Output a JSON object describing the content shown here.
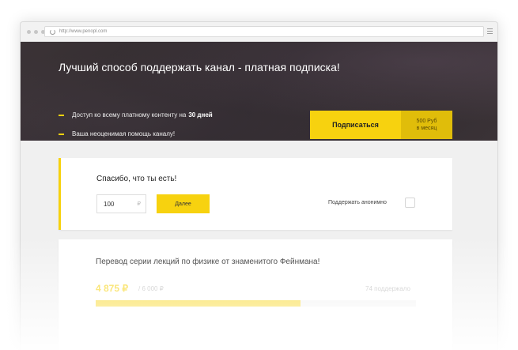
{
  "browser": {
    "url": "http://www.penopl.com",
    "menu_icon": "hamburger-icon",
    "reload_icon": "reload-icon"
  },
  "hero": {
    "title": "Лучший способ поддержать канал - платная подписка!",
    "benefits": [
      {
        "text": "Доступ ко всему платному контенту на",
        "highlight": "30 дней"
      },
      {
        "text": "Ваша неоценимая помощь каналу!"
      }
    ],
    "subscribe_button": {
      "label": "Подписаться",
      "price": "500 Руб",
      "period": "в месяц"
    }
  },
  "donation": {
    "title": "Спасибо, что ты есть!",
    "amount_value": "100",
    "currency": "₽",
    "next_label": "Далее",
    "anonymous_label": "Поддержать анонимно",
    "anonymous_checked": false
  },
  "campaign": {
    "title": "Перевод серии лекций по физике от знаменитого Фейнмана!",
    "raised": "4 875 ₽",
    "goal": "/ 6 000 ₽",
    "supporters": "74 поддержало",
    "progress_fraction": 0.64
  },
  "colors": {
    "accent": "#f7d20f",
    "accent_dark": "#e0bd0a",
    "hero_bg": "#332c30"
  }
}
